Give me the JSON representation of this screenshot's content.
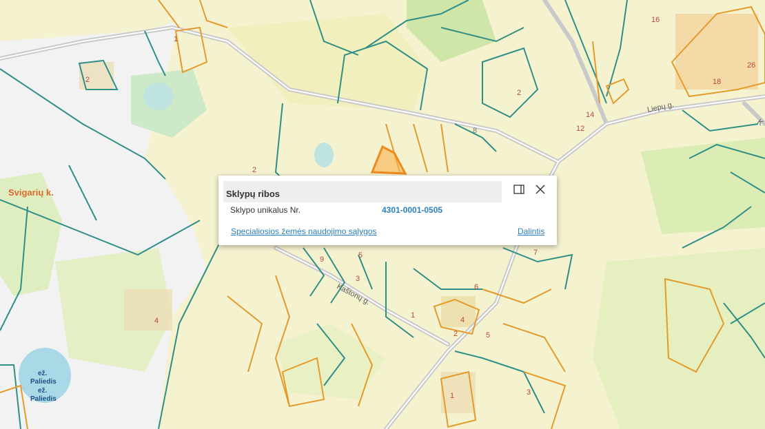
{
  "map": {
    "place_labels": {
      "village": "Svigarių k.",
      "lake_top": "ež.\nPaliedis",
      "lake_bottom": "ež.\nPaliedis",
      "street_liepu": "Liepų g.",
      "street_kastonu": "Kaštonų g.",
      "street_edge": "K"
    },
    "parcel_numbers": [
      "1",
      "2",
      "2",
      "16",
      "18",
      "26",
      "2",
      "14",
      "12",
      "8",
      "9",
      "5",
      "3",
      "7",
      "6",
      "1",
      "4",
      "2",
      "5",
      "4",
      "1",
      "3"
    ],
    "colors": {
      "background": "#eef3cf",
      "parcel_green": "#2f8f86",
      "parcel_orange": "#e59a2a",
      "selected_parcel": "#f5a442",
      "water": "#a9d8e6",
      "road": "#c8c8c8"
    }
  },
  "popup": {
    "title": "Sklypų ribos",
    "field_label": "Sklypo unikalus Nr.",
    "field_value": "4301-0001-0505",
    "special_conditions_link": "Specialiosios žemės naudojimo sąlygos",
    "share_link": "Dalintis",
    "dock_icon": "dock-panel-icon",
    "close_icon": "close-icon"
  }
}
